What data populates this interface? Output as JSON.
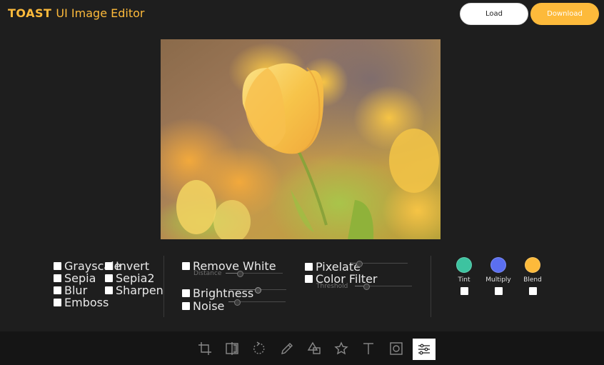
{
  "header": {
    "logo_brand": "TOAST",
    "logo_name": "UI Image Editor",
    "load_label": "Load",
    "download_label": "Download"
  },
  "filters": {
    "column1": [
      "Grayscale",
      "Sepia",
      "Blur",
      "Emboss"
    ],
    "column2": [
      "Invert",
      "Sepia2",
      "Sharpen"
    ],
    "remove_white": {
      "label": "Remove White",
      "sub_label": "Distance"
    },
    "brightness": {
      "label": "Brightness"
    },
    "noise": {
      "label": "Noise"
    },
    "pixelate": {
      "label": "Pixelate"
    },
    "color_filter": {
      "label": "Color Filter",
      "sub_label": "Threshold"
    },
    "swatches": [
      {
        "label": "Tint",
        "color": "#3dc3a0"
      },
      {
        "label": "Multiply",
        "color": "#5b6ff0"
      },
      {
        "label": "Blend",
        "color": "#fdba3b"
      }
    ]
  },
  "slider_levels": {
    "distance": 0.25,
    "brightness": 0.5,
    "noise": 0.15,
    "pixelate": 0.15,
    "threshold": 0.2
  },
  "toolbar": {
    "tools": [
      "crop-icon",
      "flip-icon",
      "rotate-icon",
      "draw-icon",
      "shape-icon",
      "icon-icon",
      "text-icon",
      "mask-icon",
      "filter-icon"
    ],
    "active_tool": "filter-icon"
  },
  "colors": {
    "accent": "#fdba3b",
    "background": "#1e1e1e",
    "toolbar_background": "#151515"
  }
}
